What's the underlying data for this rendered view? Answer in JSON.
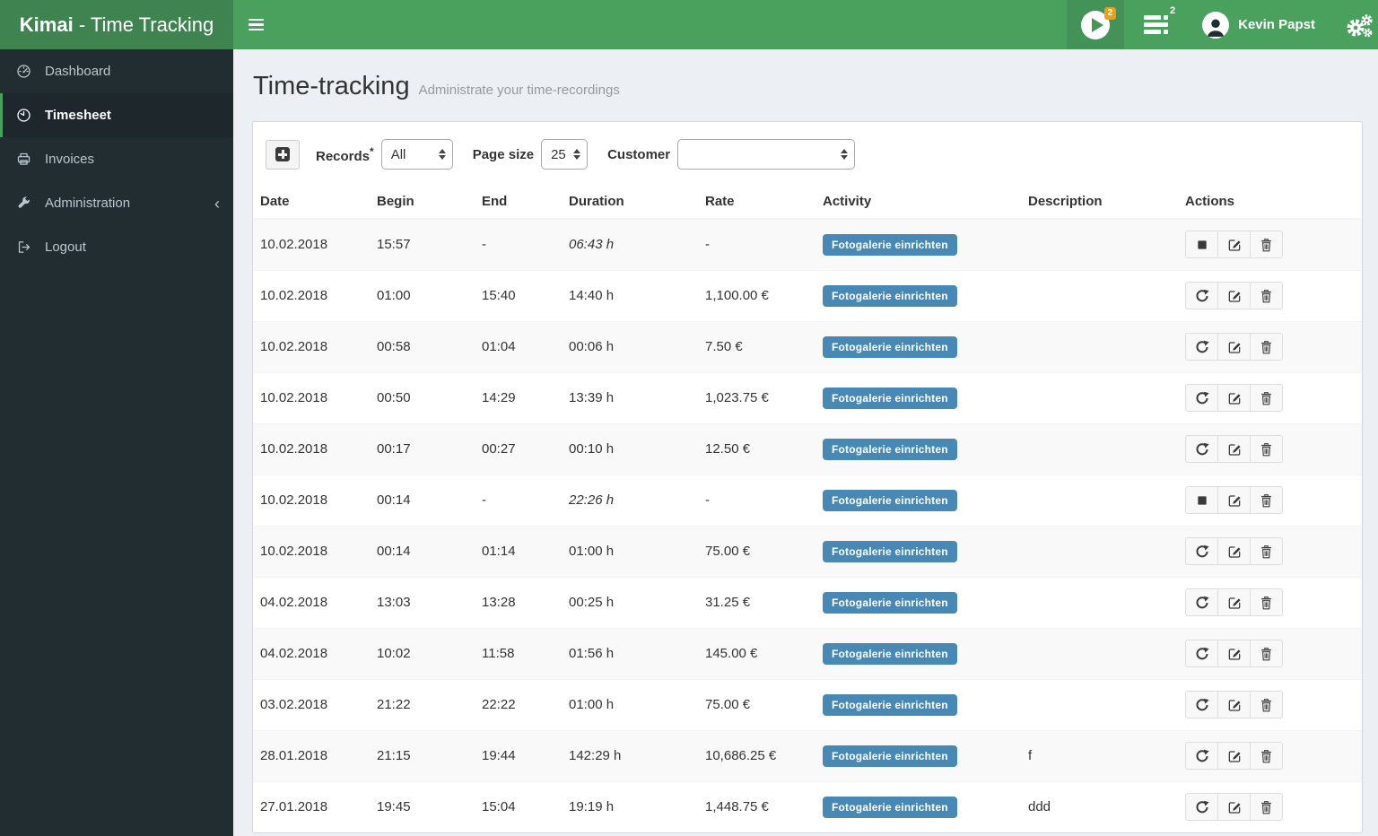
{
  "colors": {
    "navbar_green": "#4aa05d",
    "logo_green": "#3e8350",
    "sidebar_bg": "#222d32",
    "page_bg": "#ecf0f5",
    "activity_badge_blue": "#4789b4",
    "notification_badge_orange": "#f39c12"
  },
  "navbar": {
    "brand_bold": "Kimai",
    "brand_rest": " - Time Tracking",
    "hamburger_icon": "menu-icon",
    "play_icon": "start-timer-icon",
    "play_badge": "2",
    "tasks_icon": "active-records-icon",
    "tasks_badge": "2",
    "user_icon": "user-avatar",
    "user_name": "Kevin Papst",
    "settings_icon": "gears-icon"
  },
  "sidebar": {
    "items": [
      {
        "label": "Dashboard",
        "icon": "dashboard-icon",
        "active": false
      },
      {
        "label": "Timesheet",
        "icon": "clock-icon",
        "active": true
      },
      {
        "label": "Invoices",
        "icon": "printer-icon",
        "active": false
      },
      {
        "label": "Administration",
        "icon": "wrench-icon",
        "active": false,
        "chevron": "‹"
      },
      {
        "label": "Logout",
        "icon": "logout-icon",
        "active": false
      }
    ]
  },
  "page": {
    "title": "Time-tracking",
    "subtitle": "Administrate your time-recordings"
  },
  "toolbar": {
    "add_button_icon": "plus-square-icon",
    "records_label": "Records",
    "records_required_mark": "*",
    "records_value": "All",
    "page_size_label": "Page size",
    "page_size_value": "25",
    "customer_label": "Customer",
    "customer_value": ""
  },
  "table": {
    "headers": [
      "Date",
      "Begin",
      "End",
      "Duration",
      "Rate",
      "Activity",
      "Description",
      "Actions"
    ],
    "rows": [
      {
        "date": "10.02.2018",
        "begin": "15:57",
        "end": "-",
        "duration": "06:43 h",
        "duration_italic": true,
        "rate": "-",
        "activity": "Fotogalerie einrichten",
        "description": "",
        "actions": [
          "stop",
          "edit",
          "trash"
        ]
      },
      {
        "date": "10.02.2018",
        "begin": "01:00",
        "end": "15:40",
        "duration": "14:40 h",
        "duration_italic": false,
        "rate": "1,100.00 €",
        "activity": "Fotogalerie einrichten",
        "description": "",
        "actions": [
          "repeat",
          "edit",
          "trash"
        ]
      },
      {
        "date": "10.02.2018",
        "begin": "00:58",
        "end": "01:04",
        "duration": "00:06 h",
        "duration_italic": false,
        "rate": "7.50 €",
        "activity": "Fotogalerie einrichten",
        "description": "",
        "actions": [
          "repeat",
          "edit",
          "trash"
        ]
      },
      {
        "date": "10.02.2018",
        "begin": "00:50",
        "end": "14:29",
        "duration": "13:39 h",
        "duration_italic": false,
        "rate": "1,023.75 €",
        "activity": "Fotogalerie einrichten",
        "description": "",
        "actions": [
          "repeat",
          "edit",
          "trash"
        ]
      },
      {
        "date": "10.02.2018",
        "begin": "00:17",
        "end": "00:27",
        "duration": "00:10 h",
        "duration_italic": false,
        "rate": "12.50 €",
        "activity": "Fotogalerie einrichten",
        "description": "",
        "actions": [
          "repeat",
          "edit",
          "trash"
        ]
      },
      {
        "date": "10.02.2018",
        "begin": "00:14",
        "end": "-",
        "duration": "22:26 h",
        "duration_italic": true,
        "rate": "-",
        "activity": "Fotogalerie einrichten",
        "description": "",
        "actions": [
          "stop",
          "edit",
          "trash"
        ]
      },
      {
        "date": "10.02.2018",
        "begin": "00:14",
        "end": "01:14",
        "duration": "01:00 h",
        "duration_italic": false,
        "rate": "75.00 €",
        "activity": "Fotogalerie einrichten",
        "description": "",
        "actions": [
          "repeat",
          "edit",
          "trash"
        ]
      },
      {
        "date": "04.02.2018",
        "begin": "13:03",
        "end": "13:28",
        "duration": "00:25 h",
        "duration_italic": false,
        "rate": "31.25 €",
        "activity": "Fotogalerie einrichten",
        "description": "",
        "actions": [
          "repeat",
          "edit",
          "trash"
        ]
      },
      {
        "date": "04.02.2018",
        "begin": "10:02",
        "end": "11:58",
        "duration": "01:56 h",
        "duration_italic": false,
        "rate": "145.00 €",
        "activity": "Fotogalerie einrichten",
        "description": "",
        "actions": [
          "repeat",
          "edit",
          "trash"
        ]
      },
      {
        "date": "03.02.2018",
        "begin": "21:22",
        "end": "22:22",
        "duration": "01:00 h",
        "duration_italic": false,
        "rate": "75.00 €",
        "activity": "Fotogalerie einrichten",
        "description": "",
        "actions": [
          "repeat",
          "edit",
          "trash"
        ]
      },
      {
        "date": "28.01.2018",
        "begin": "21:15",
        "end": "19:44",
        "duration": "142:29 h",
        "duration_italic": false,
        "rate": "10,686.25 €",
        "activity": "Fotogalerie einrichten",
        "description": "f",
        "actions": [
          "repeat",
          "edit",
          "trash"
        ]
      },
      {
        "date": "27.01.2018",
        "begin": "19:45",
        "end": "15:04",
        "duration": "19:19 h",
        "duration_italic": false,
        "rate": "1,448.75 €",
        "activity": "Fotogalerie einrichten",
        "description": "ddd",
        "actions": [
          "repeat",
          "edit",
          "trash"
        ]
      }
    ]
  }
}
